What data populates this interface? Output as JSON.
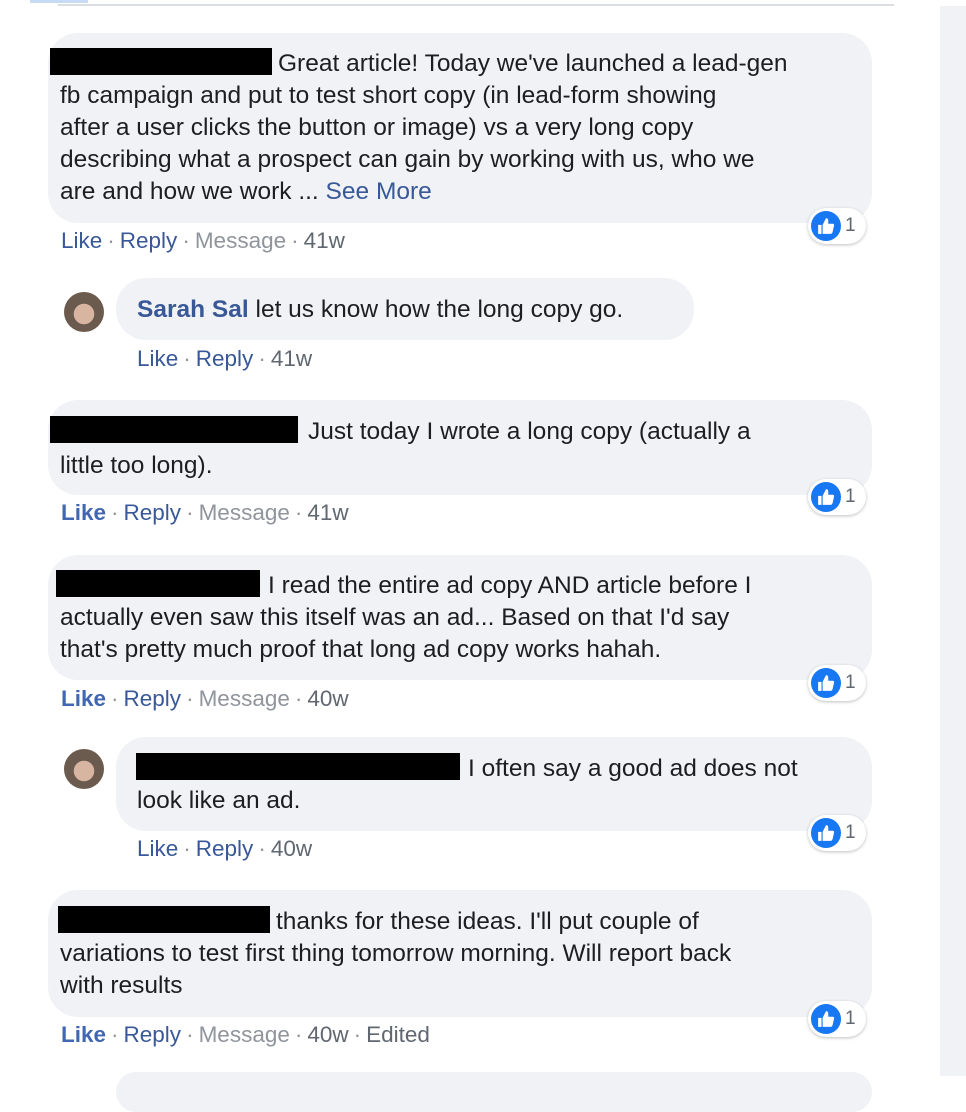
{
  "comments": [
    {
      "lines": [
        "Great article! Today we've launched a lead-gen",
        "fb campaign and put to test short copy (in lead-form showing",
        "after a user clicks the button or image) vs a very long copy",
        "describing what a prospect can gain by working with us, who we",
        "are and how we work ..."
      ],
      "see_more": "See More",
      "actions": {
        "like": "Like",
        "reply": "Reply",
        "message": "Message",
        "time": "41w"
      },
      "reaction_count": "1"
    },
    {
      "author": "Sarah Sal",
      "lines": [
        "let us know how the long copy go."
      ],
      "actions": {
        "like": "Like",
        "reply": "Reply",
        "time": "41w"
      }
    },
    {
      "lines": [
        "Just today I wrote a long copy (actually a",
        "little too long)."
      ],
      "actions": {
        "like": "Like",
        "reply": "Reply",
        "message": "Message",
        "time": "41w"
      },
      "reaction_count": "1"
    },
    {
      "lines": [
        "I read the entire ad copy AND article before I",
        "actually even saw this itself was an ad... Based on that I'd say",
        "that's pretty much proof that long ad copy works hahah."
      ],
      "actions": {
        "like": "Like",
        "reply": "Reply",
        "message": "Message",
        "time": "40w"
      },
      "reaction_count": "1"
    },
    {
      "lines": [
        "I often say a good ad does not",
        "look like an ad."
      ],
      "actions": {
        "like": "Like",
        "reply": "Reply",
        "time": "40w"
      },
      "reaction_count": "1"
    },
    {
      "lines": [
        "thanks for these ideas. I'll put couple of",
        "variations to test first thing tomorrow morning. Will report back",
        "with results"
      ],
      "actions": {
        "like": "Like",
        "reply": "Reply",
        "message": "Message",
        "time": "40w",
        "edited": "Edited"
      },
      "reaction_count": "1"
    }
  ],
  "icons": {
    "reaction": "like-thumb-icon",
    "avatar": "user-avatar"
  },
  "colors": {
    "bubble": "#f0f2f5",
    "link": "#385898",
    "like_badge": "#1877f2"
  }
}
